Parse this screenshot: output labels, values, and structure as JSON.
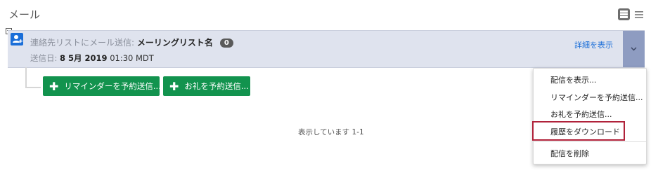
{
  "page": {
    "title": "メール"
  },
  "card": {
    "prefix": "連絡先リストにメール送信: ",
    "list_name": "メーリングリスト名",
    "badge_count": "0",
    "sent_label": "送信日: ",
    "sent_date": "8 5月 2019",
    "sent_time": " 01:30 MDT",
    "details_link": "詳細を表示"
  },
  "actions": {
    "reminder_button": "リマインダーを予約送信...",
    "thanks_button": "お礼を予約送信..."
  },
  "status": {
    "text": "表示しています 1-1"
  },
  "menu": {
    "items": [
      "配信を表示...",
      "リマインダーを予約送信...",
      "お礼を予約送信...",
      "履歴をダウンロード",
      "配信を削除"
    ]
  },
  "colors": {
    "accent": "#1a6ed8",
    "card_bg": "#dfe3ee",
    "dropdown_bg": "#8e9cc1",
    "button_green": "#12934e",
    "highlight": "#b0223a"
  }
}
